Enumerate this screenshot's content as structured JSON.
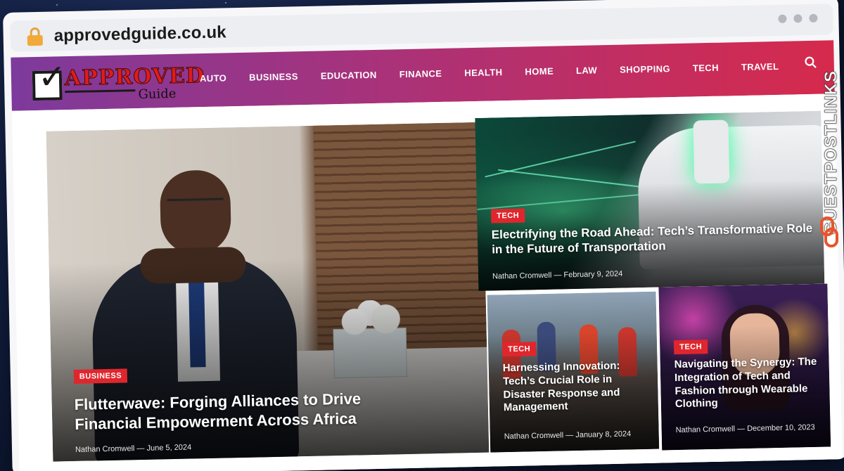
{
  "browser": {
    "url": "approvedguide.co.uk"
  },
  "site": {
    "logo_word": "APPROVED",
    "logo_sub": "Guide",
    "nav": [
      "AUTO",
      "BUSINESS",
      "EDUCATION",
      "FINANCE",
      "HEALTH",
      "HOME",
      "LAW",
      "SHOPPING",
      "TECH",
      "TRAVEL"
    ]
  },
  "watermark": "GUESTPOSTLINKS",
  "articles": {
    "main": {
      "category": "BUSINESS",
      "title": "Flutterwave: Forging Alliances to Drive Financial Empowerment Across Africa",
      "author": "Nathan Cromwell",
      "date": "June 5, 2024"
    },
    "top_right": {
      "category": "TECH",
      "title": "Electrifying the Road Ahead: Tech’s Transformative Role in the Future of Transportation",
      "author": "Nathan Cromwell",
      "date": "February 9, 2024"
    },
    "bottom_left": {
      "category": "TECH",
      "title": "Harnessing Innovation: Tech’s Crucial Role in Disaster Response and Management",
      "author": "Nathan Cromwell",
      "date": "January 8, 2024"
    },
    "bottom_right": {
      "category": "TECH",
      "title": "Navigating the Synergy: The Integration of Tech and Fashion through Wearable Clothing",
      "author": "Nathan Cromwell",
      "date": "December 10, 2023"
    }
  },
  "colors": {
    "badge": "#e0262d",
    "header_start": "#7d3a9c",
    "header_end": "#d62a4c"
  }
}
